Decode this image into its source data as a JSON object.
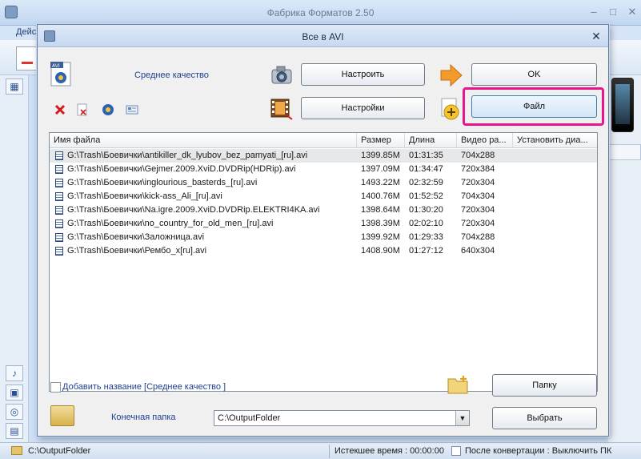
{
  "main_window": {
    "title": "Фабрика Форматов 2.50",
    "menu_first_item": "Дейс",
    "controls": {
      "minimize": "–",
      "maximize": "□",
      "close": "✕"
    },
    "left_tabs": [
      "▦",
      "♪",
      "▣",
      "◎",
      "▤"
    ],
    "status": {
      "output_path": "C:\\OutputFolder",
      "elapsed": "Истекшее время : 00:00:00",
      "after_conversion": "После конвертации : Выключить ПК"
    }
  },
  "dialog": {
    "title": "Все в AVI",
    "close": "✕",
    "quality_label": "Среднее качество",
    "buttons": {
      "configure": "Настроить",
      "ok": "OK",
      "settings": "Настройки",
      "file": "Файл",
      "folder": "Папку",
      "browse": "Выбрать"
    },
    "list": {
      "columns": [
        "Имя файла",
        "Размер",
        "Длина",
        "Видео ра...",
        "Установить диа..."
      ],
      "rows": [
        [
          "G:\\Trash\\Боевички\\antikiller_dk_lyubov_bez_pamyati_[ru].avi",
          "1399.85M",
          "01:31:35",
          "704x288",
          ""
        ],
        [
          "G:\\Trash\\Боевички\\Gejmer.2009.XviD.DVDRip(HDRip).avi",
          "1397.09M",
          "01:34:47",
          "720x384",
          ""
        ],
        [
          "G:\\Trash\\Боевички\\inglourious_basterds_[ru].avi",
          "1493.22M",
          "02:32:59",
          "720x304",
          ""
        ],
        [
          "G:\\Trash\\Боевички\\kick-ass_Ali_[ru].avi",
          "1400.76M",
          "01:52:52",
          "704x304",
          ""
        ],
        [
          "G:\\Trash\\Боевички\\Na.igre.2009.XviD.DVDRip.ELEKTRI4KA.avi",
          "1398.64M",
          "01:30:20",
          "720x304",
          ""
        ],
        [
          "G:\\Trash\\Боевички\\no_country_for_old_men_[ru].avi",
          "1398.39M",
          "02:02:10",
          "720x304",
          ""
        ],
        [
          "G:\\Trash\\Боевички\\Заложница.avi",
          "1399.92M",
          "01:29:33",
          "704x288",
          ""
        ],
        [
          "G:\\Trash\\Боевички\\Рембо_x[ru].avi",
          "1408.90M",
          "01:27:12",
          "640x304",
          ""
        ]
      ],
      "selected_row": 0
    },
    "add_title_label": "Добавить название [Среднее качество ]",
    "output_folder_label": "Конечная папка",
    "output_folder_value": "C:\\OutputFolder",
    "combo_arrow": "▼",
    "colors": {
      "highlight": "#e8158d",
      "label_blue": "#1f3f8f"
    }
  }
}
